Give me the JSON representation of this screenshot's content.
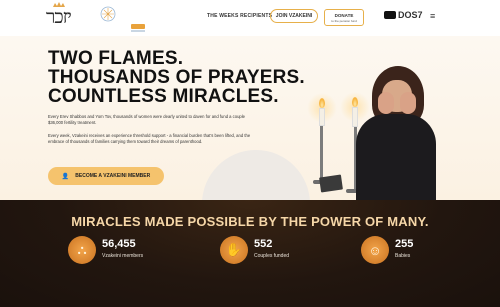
{
  "header": {
    "logo_text": "יזכר",
    "nav": [
      {
        "label": "THE WEEKS RECIPIENTS"
      },
      {
        "label": "JOIN VZAKEINI"
      }
    ],
    "donate": {
      "label": "DONATE",
      "sub": "to the pension fund"
    },
    "radio": {
      "label": "DOS7"
    },
    "menu_icon": "hamburger-icon"
  },
  "hero": {
    "headline": [
      "TWO FLAMES.",
      "THOUSANDS OF PRAYERS.",
      "COUNTLESS MIRACLES."
    ],
    "paragraph_1": "Every Erev Shabbos and Yom Tov, thousands of women were dearly united to daven for and fund a couple $36,000 fertility treatment.",
    "paragraph_2": "Every week, Vzakeini receives an experience threshold support - a financial burden that's been lifted, and the embrace of thousands of families carrying them toward their dreams of parenthood.",
    "cta_label": "BECOME A VZAKEINI MEMBER",
    "cta_icon": "user-plus-icon"
  },
  "stats": {
    "title": "MIRACLES MADE POSSIBLE BY THE POWER OF MANY.",
    "items": [
      {
        "value": "56,455",
        "label": "Vzakeini members",
        "icon": "crowd-icon"
      },
      {
        "value": "552",
        "label": "Couples funded",
        "icon": "hands-icon"
      },
      {
        "value": "255",
        "label": "Babies",
        "icon": "baby-icon"
      }
    ]
  },
  "colors": {
    "accent": "#f5c36d",
    "stats_bg": "#22160f",
    "stats_title": "#f6d7a8",
    "icon": "#e88f2f"
  }
}
